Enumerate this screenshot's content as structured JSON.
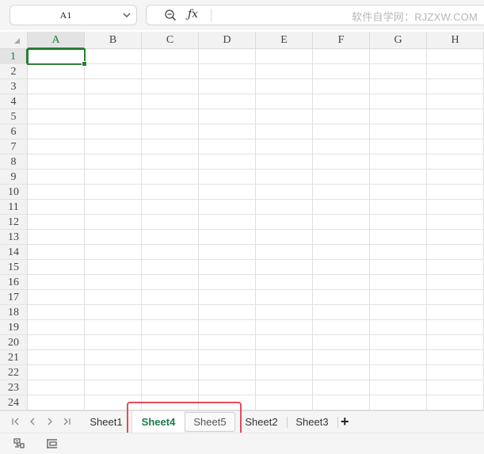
{
  "formula_bar": {
    "name_box": "A1",
    "watermark": "软件自学网：RJZXW.COM"
  },
  "grid": {
    "columns": [
      "A",
      "B",
      "C",
      "D",
      "E",
      "F",
      "G",
      "H"
    ],
    "rows": [
      "1",
      "2",
      "3",
      "4",
      "5",
      "6",
      "7",
      "8",
      "9",
      "10",
      "11",
      "12",
      "13",
      "14",
      "15",
      "16",
      "17",
      "18",
      "19",
      "20",
      "21",
      "22",
      "23",
      "24"
    ],
    "active_cell": "A1",
    "active_color": "#2e7d32"
  },
  "sheet_tabs": {
    "tabs": [
      "Sheet1",
      "Sheet4",
      "Sheet5",
      "Sheet2",
      "Sheet3"
    ],
    "active": "Sheet4",
    "add_label": "+",
    "highlight_color": "#e24b5a"
  },
  "icons": {
    "name_box_dropdown": "chevron-down-icon",
    "zoom": "zoom-icon",
    "function": "fx-icon",
    "nav": [
      "first-sheet-icon",
      "prev-sheet-icon",
      "next-sheet-icon",
      "last-sheet-icon"
    ],
    "status": [
      "macro-icon",
      "outline-icon"
    ]
  }
}
